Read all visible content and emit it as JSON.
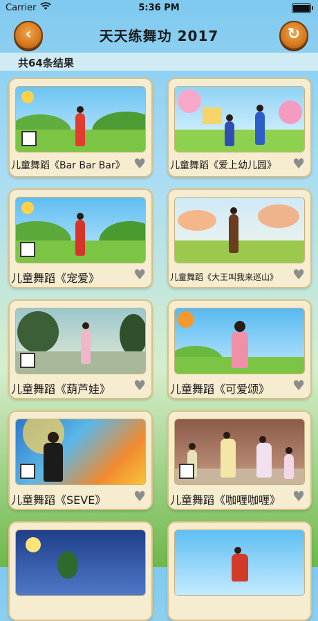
{
  "status": {
    "carrier": "Carrier",
    "time": "5:36 PM"
  },
  "nav": {
    "title": "天天练舞功 2017",
    "back_icon": "‹",
    "refresh_icon": "↻"
  },
  "result": {
    "text": "共64条结果"
  },
  "colors": {
    "card_bg": "#f6ecd0",
    "card_border": "#d8c189",
    "button_orange": "#d4781f"
  },
  "items": [
    {
      "title": "儿童舞蹈《Bar Bar Bar》"
    },
    {
      "title": "儿童舞蹈《爱上幼儿园》"
    },
    {
      "title": "儿童舞蹈《宠爱》"
    },
    {
      "title": "儿童舞蹈《大王叫我来巡山》"
    },
    {
      "title": "儿童舞蹈《葫芦娃》"
    },
    {
      "title": "儿童舞蹈《可爱颂》"
    },
    {
      "title": "儿童舞蹈《SEVE》"
    },
    {
      "title": "儿童舞蹈《咖喱咖喱》"
    }
  ]
}
